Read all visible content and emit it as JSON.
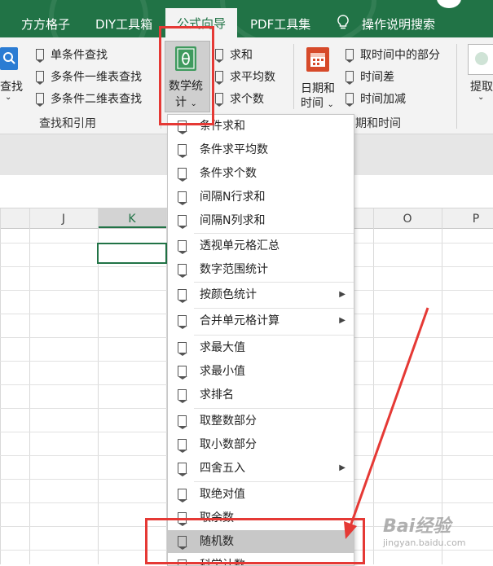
{
  "tabs": [
    {
      "label": "方方格子"
    },
    {
      "label": "DIY工具箱"
    },
    {
      "label": "公式向导"
    },
    {
      "label": "PDF工具集"
    },
    {
      "label": "操作说明搜索"
    }
  ],
  "ribbon": {
    "lookup_button": "查找",
    "lookup_items": [
      "单条件查找",
      "多条件一维表查找",
      "多条件二维表查找"
    ],
    "lookup_group": "查找和引用",
    "math_button_line1": "数学统",
    "math_button_line2": "计",
    "math_items": [
      "求和",
      "求平均数",
      "求个数"
    ],
    "date_button_line1": "日期和",
    "date_button_line2": "时间",
    "date_items": [
      "取时间中的部分",
      "时间差",
      "时间加减"
    ],
    "date_group": "期和时间",
    "extract_button": "提取"
  },
  "columns": [
    "J",
    "K",
    "O",
    "P"
  ],
  "menu": {
    "items": [
      {
        "label": "条件求和",
        "submenu": false
      },
      {
        "label": "条件求平均数",
        "submenu": false
      },
      {
        "label": "条件求个数",
        "submenu": false
      },
      {
        "label": "间隔N行求和",
        "submenu": false
      },
      {
        "label": "间隔N列求和",
        "submenu": false
      },
      {
        "label": "透视单元格汇总",
        "submenu": false
      },
      {
        "label": "数字范围统计",
        "submenu": false
      },
      {
        "label": "按颜色统计",
        "submenu": true
      },
      {
        "label": "合并单元格计算",
        "submenu": true
      },
      {
        "label": "求最大值",
        "submenu": false
      },
      {
        "label": "求最小值",
        "submenu": false
      },
      {
        "label": "求排名",
        "submenu": false
      },
      {
        "label": "取整数部分",
        "submenu": false
      },
      {
        "label": "取小数部分",
        "submenu": false
      },
      {
        "label": "四舍五入",
        "submenu": true
      },
      {
        "label": "取绝对值",
        "submenu": false
      },
      {
        "label": "取余数",
        "submenu": false
      },
      {
        "label": "随机数",
        "submenu": false,
        "highlighted": true
      },
      {
        "label": "科学计数",
        "submenu": false
      }
    ]
  },
  "watermark": "Bai经验",
  "watermark_sub": "jingyan.baidu.com",
  "colors": {
    "ribbon_green": "#217346",
    "annotation_red": "#e53935",
    "highlight": "#c8c8c8"
  }
}
